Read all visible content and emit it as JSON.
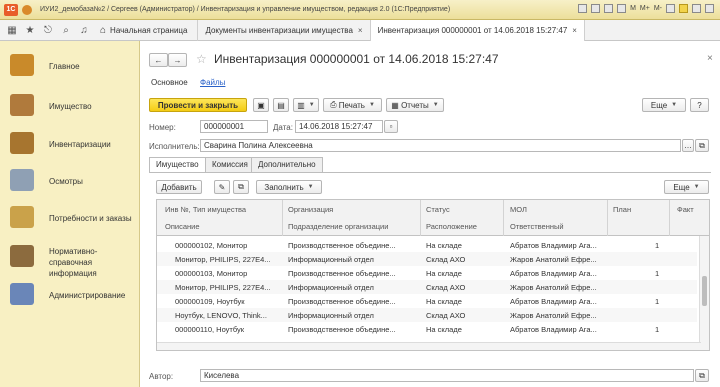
{
  "window": {
    "logo": "1С",
    "title": "ИУИ2_демобаза№2 / Сергеев (Администратор) / Инвентаризация и управление имуществом, редакция 2.0 (1С:Предприятие)",
    "right_letters": [
      "M",
      "M+",
      "M-"
    ]
  },
  "tabs": {
    "home_label": "Начальная страница",
    "items": [
      {
        "label": "Документы инвентаризации имущества",
        "close": "×"
      },
      {
        "label": "Инвентаризация 000000001 от 14.06.2018 15:27:47",
        "close": "×"
      }
    ]
  },
  "sidebar": {
    "items": [
      {
        "label": "Главное",
        "icon": "desk-icon",
        "color": "#c98a2a"
      },
      {
        "label": "Имущество",
        "icon": "furniture-icon",
        "color": "#b07a3c"
      },
      {
        "label": "Инвентаризации",
        "icon": "boxes-icon",
        "color": "#a7752f"
      },
      {
        "label": "Осмотры",
        "icon": "clipboard-icon",
        "color": "#8fa0b4"
      },
      {
        "label": "Потребности и заказы",
        "icon": "cart-icon",
        "color": "#caa24a"
      },
      {
        "label": "Нормативно-справочная информация",
        "icon": "books-icon",
        "color": "#8c6b3e"
      },
      {
        "label": "Администрирование",
        "icon": "admin-icon",
        "color": "#6a86b8"
      }
    ]
  },
  "form": {
    "title": "Инвентаризация 000000001 от 14.06.2018 15:27:47",
    "nav_back": "←",
    "nav_fwd": "→",
    "star": "☆",
    "close": "×",
    "sublinks": {
      "main": "Основное",
      "files": "Файлы"
    },
    "toolbar": {
      "post_close": "Провести и закрыть",
      "print": "Печать",
      "reports": "Отчеты",
      "more": "Еще",
      "help": "?"
    },
    "number_label": "Номер:",
    "number_value": "000000001",
    "date_label": "Дата:",
    "date_value": "14.06.2018 15:27:47",
    "executor_label": "Исполнитель:",
    "executor_value": "Сварина Полина Алексеевна",
    "tabs": [
      "Имущество",
      "Комиссия",
      "Дополнительно"
    ],
    "table_toolbar": {
      "add": "Добавить",
      "fill": "Заполнить",
      "more": "Еще"
    },
    "columns": {
      "inv_type": "Инв №, Тип имущества",
      "description": "Описание",
      "org": "Организация",
      "dept": "Подразделение организации",
      "status": "Статус",
      "location": "Расположение",
      "mol": "МОЛ",
      "responsible": "Ответственный",
      "plan": "План",
      "fact": "Факт"
    },
    "rows": [
      {
        "a": "000000102, Монитор",
        "b": "Производственное объедине...",
        "c": "На складе",
        "d": "Абратов Владимир Ага...",
        "plan": "1"
      },
      {
        "a": "Монитор, PHILIPS, 227E4...",
        "b": "Информационный отдел",
        "c": "Склад АХО",
        "d": "Жаров Анатолий Ефре...",
        "plan": ""
      },
      {
        "a": "000000103, Монитор",
        "b": "Производственное объедине...",
        "c": "На складе",
        "d": "Абратов Владимир Ага...",
        "plan": "1"
      },
      {
        "a": "Монитор, PHILIPS, 227E4...",
        "b": "Информационный отдел",
        "c": "Склад АХО",
        "d": "Жаров Анатолий Ефре...",
        "plan": ""
      },
      {
        "a": "000000109, Ноутбук",
        "b": "Производственное объедине...",
        "c": "На складе",
        "d": "Абратов Владимир Ага...",
        "plan": "1"
      },
      {
        "a": "Ноутбук, LENOVO, Think...",
        "b": "Информационный отдел",
        "c": "Склад АХО",
        "d": "Жаров Анатолий Ефре...",
        "plan": ""
      },
      {
        "a": "000000110, Ноутбук",
        "b": "Производственное объедине...",
        "c": "На складе",
        "d": "Абратов Владимир Ага...",
        "plan": "1"
      }
    ],
    "author_label": "Автор:",
    "author_value": "Киселева"
  }
}
